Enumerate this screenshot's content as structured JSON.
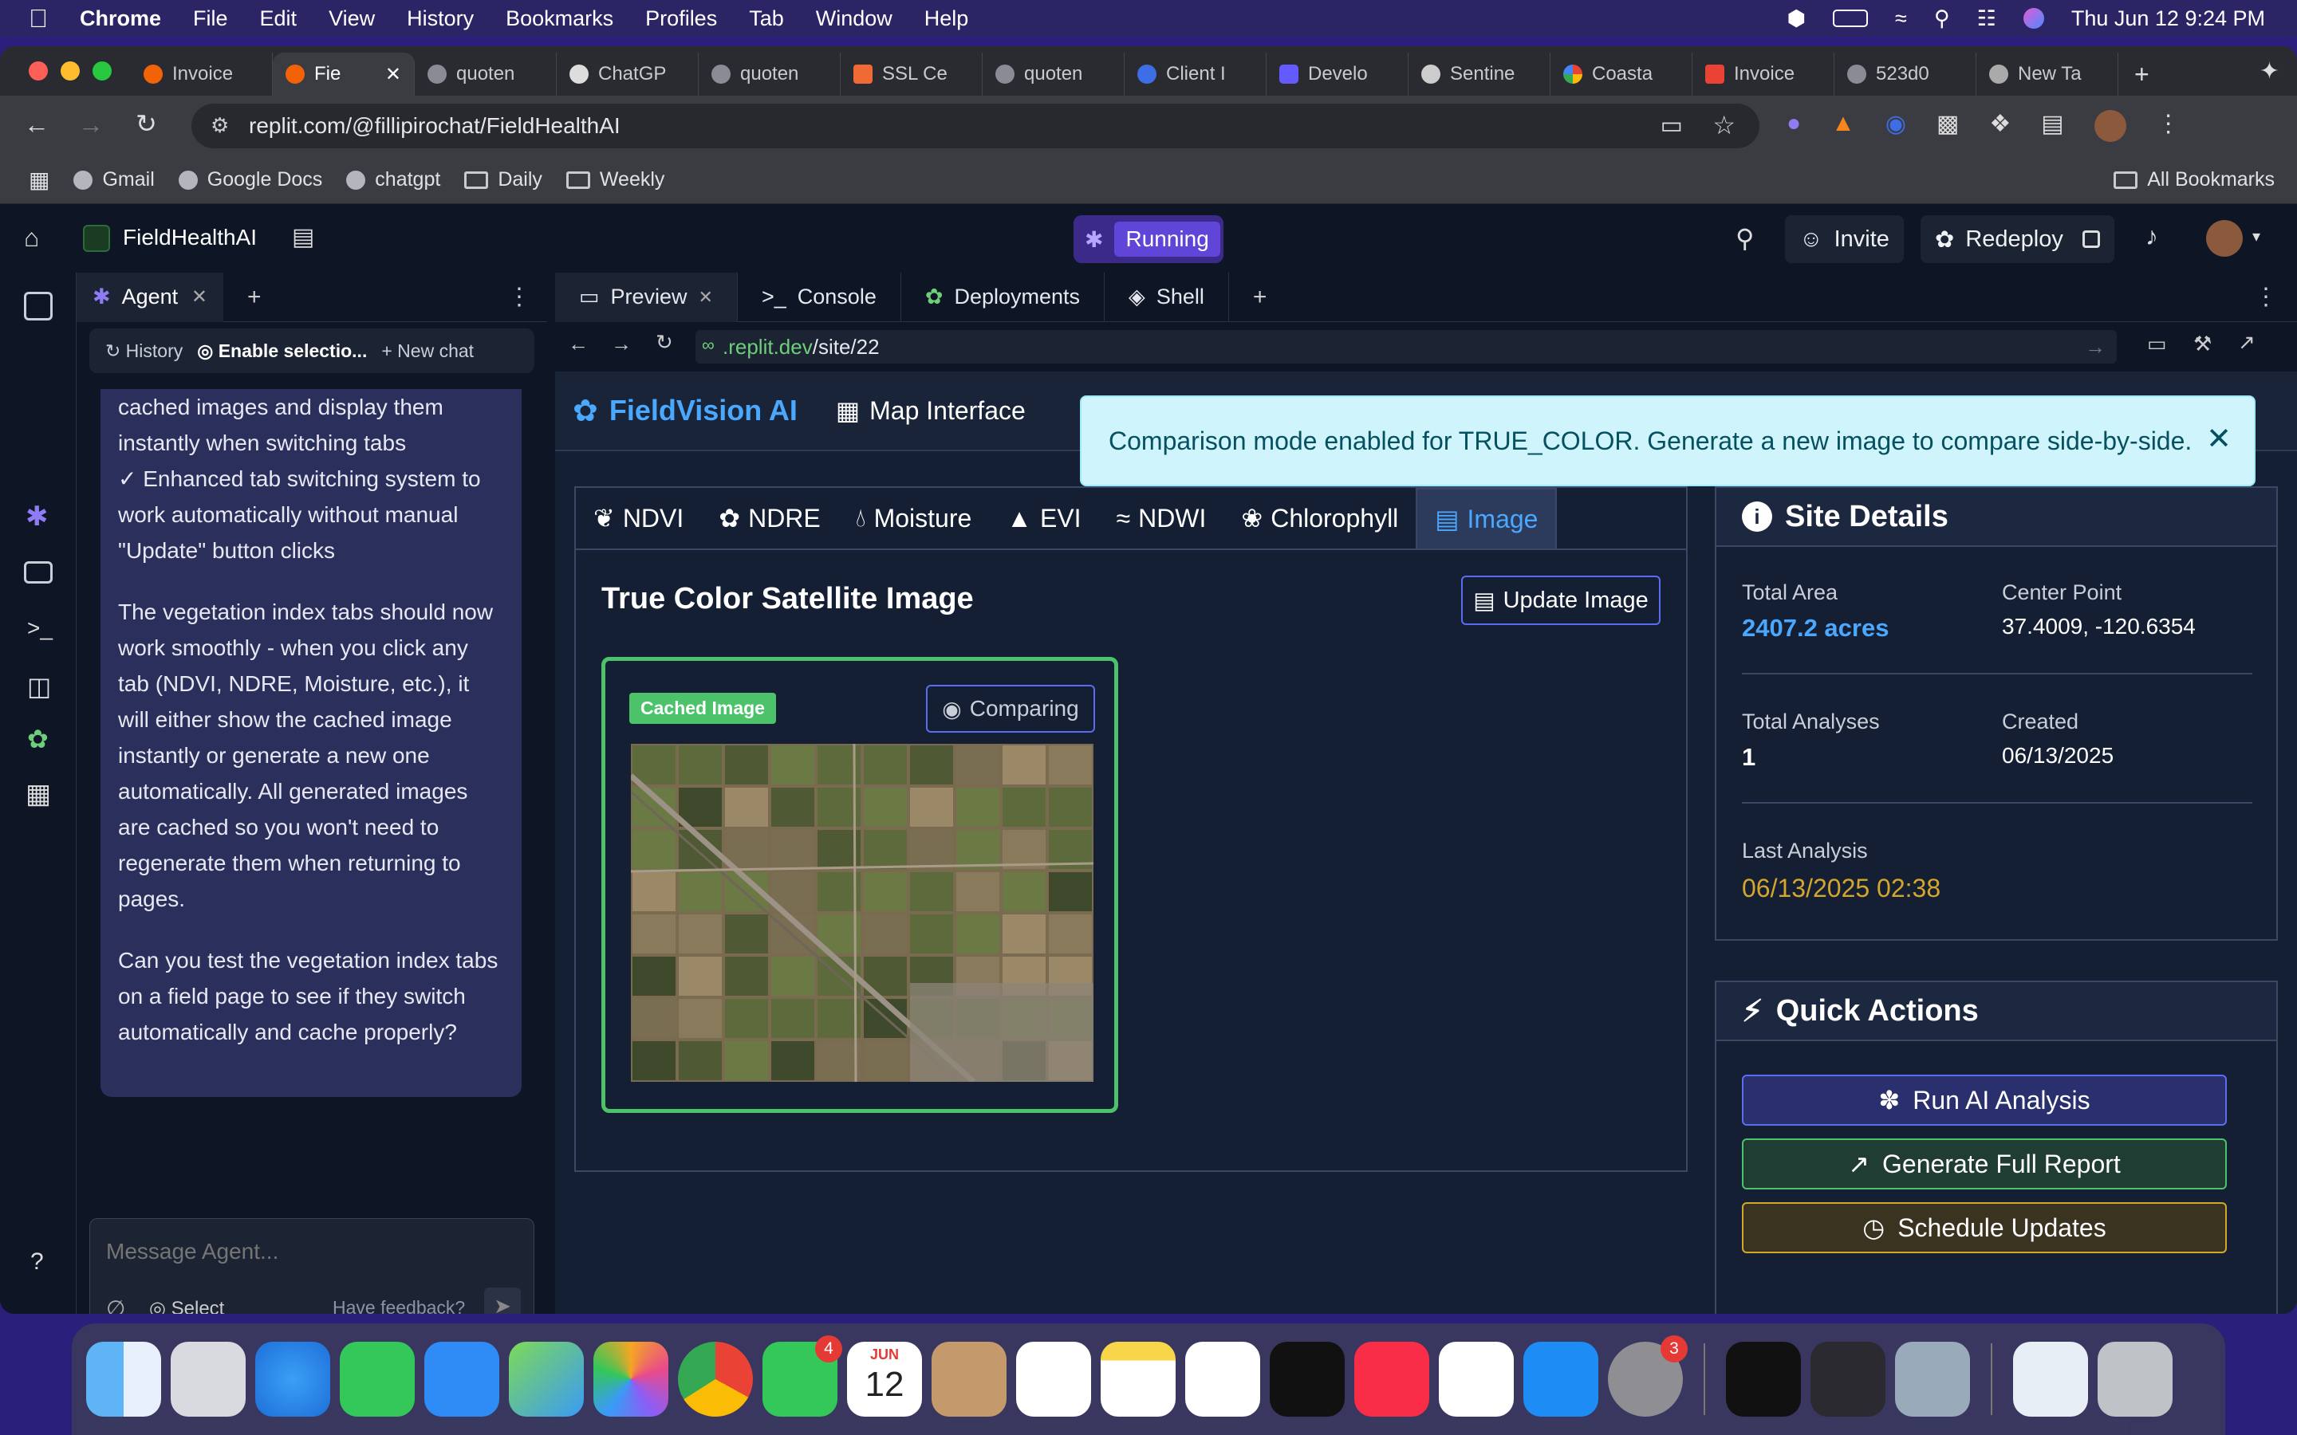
{
  "menubar": {
    "app_name": "Chrome",
    "items": [
      "File",
      "Edit",
      "View",
      "History",
      "Bookmarks",
      "Profiles",
      "Tab",
      "Window",
      "Help"
    ],
    "datetime": "Thu Jun 12  9:24 PM"
  },
  "browser": {
    "tabs": [
      {
        "label": "Invoice",
        "icon": "replit-favicon-icon"
      },
      {
        "label": "Fie",
        "icon": "replit-favicon-icon",
        "active": true
      },
      {
        "label": "quoten",
        "icon": "globe-icon"
      },
      {
        "label": "ChatGP",
        "icon": "chatgpt-icon"
      },
      {
        "label": "quoten",
        "icon": "globe-icon"
      },
      {
        "label": "SSL Ce",
        "icon": "ssl-icon"
      },
      {
        "label": "quoten",
        "icon": "globe-icon"
      },
      {
        "label": "Client I",
        "icon": "shield-icon"
      },
      {
        "label": "Develo",
        "icon": "stripe-icon"
      },
      {
        "label": "Sentine",
        "icon": "sentinel-icon"
      },
      {
        "label": "Coasta",
        "icon": "google-icon"
      },
      {
        "label": "Invoice",
        "icon": "gmail-icon"
      },
      {
        "label": "523d0",
        "icon": "globe-icon"
      },
      {
        "label": "New Ta",
        "icon": "chrome-icon"
      }
    ],
    "url": "replit.com/@fillipirochat/FieldHealthAI",
    "bookmarks": [
      "Gmail",
      "Google Docs",
      "chatgpt",
      "Daily",
      "Weekly"
    ],
    "all_bookmarks": "All Bookmarks"
  },
  "replit": {
    "project_name": "FieldHealthAI",
    "run_status": "Running",
    "invite_label": "Invite",
    "redeploy_label": "Redeploy",
    "agent": {
      "tab_label": "Agent",
      "history_label": "History",
      "enable_selection_label": "Enable selectio...",
      "new_chat_label": "New chat",
      "message": {
        "line1": "cached images and display them",
        "line2": "instantly when switching tabs",
        "bullet": "✓ Enhanced tab switching system to",
        "bullet2": "work automatically without manual",
        "bullet3": "\"Update\" button clicks",
        "para1": "The vegetation index tabs should now work smoothly - when you click any tab (NDVI, NDRE, Moisture, etc.), it will either show the cached image instantly or generate a new one automatically. All generated images are cached so you won't need to regenerate them when returning to pages.",
        "para2": "Can you test the vegetation index tabs on a field page to see if they switch automatically and cache properly?"
      },
      "composer_placeholder": "Message Agent...",
      "select_label": "Select",
      "feedback_label": "Have feedback?"
    },
    "preview": {
      "tabs": [
        "Preview",
        "Console",
        "Deployments",
        "Shell"
      ],
      "url_host": ".replit.dev",
      "url_path": "/site/22"
    }
  },
  "app": {
    "brand": "FieldVision AI",
    "nav_map": "Map Interface",
    "alert": "Comparison mode enabled for TRUE_COLOR. Generate a new image to compare side-by-side.",
    "index_tabs": [
      "NDVI",
      "NDRE",
      "Moisture",
      "EVI",
      "NDWI",
      "Chlorophyll",
      "Image"
    ],
    "active_tab": "Image",
    "section_title": "True Color Satellite Image",
    "update_button": "Update Image",
    "cached_badge": "Cached Image",
    "comparing_button": "Comparing",
    "site_details": {
      "title": "Site Details",
      "total_area_label": "Total Area",
      "total_area_value": "2407.2 acres",
      "center_label": "Center Point",
      "center_value": "37.4009, -120.6354",
      "analyses_label": "Total Analyses",
      "analyses_value": "1",
      "created_label": "Created",
      "created_value": "06/13/2025",
      "last_label": "Last Analysis",
      "last_value": "06/13/2025 02:38"
    },
    "quick_actions": {
      "title": "Quick Actions",
      "run": "Run AI Analysis",
      "report": "Generate Full Report",
      "schedule": "Schedule Updates"
    }
  },
  "dock": {
    "apps": [
      "Finder",
      "Launchpad",
      "Safari",
      "Messages",
      "Mail",
      "Maps",
      "Photos",
      "Chrome",
      "FaceTime",
      "Calendar",
      "Contacts",
      "Reminders",
      "Notes",
      "Freeform",
      "TV",
      "Music",
      "News",
      "App Store",
      "System Settings",
      "Unity",
      "Unity Hub",
      "Preview",
      "Files",
      "Trash"
    ],
    "calendar_month": "JUN",
    "calendar_day": "12",
    "facetime_badge": "4",
    "settings_badge": "3"
  },
  "colors": {
    "accent": "#4aa8ff",
    "success": "#4cc36a",
    "warning": "#d4a72c",
    "replit_bg": "#0e1525"
  }
}
